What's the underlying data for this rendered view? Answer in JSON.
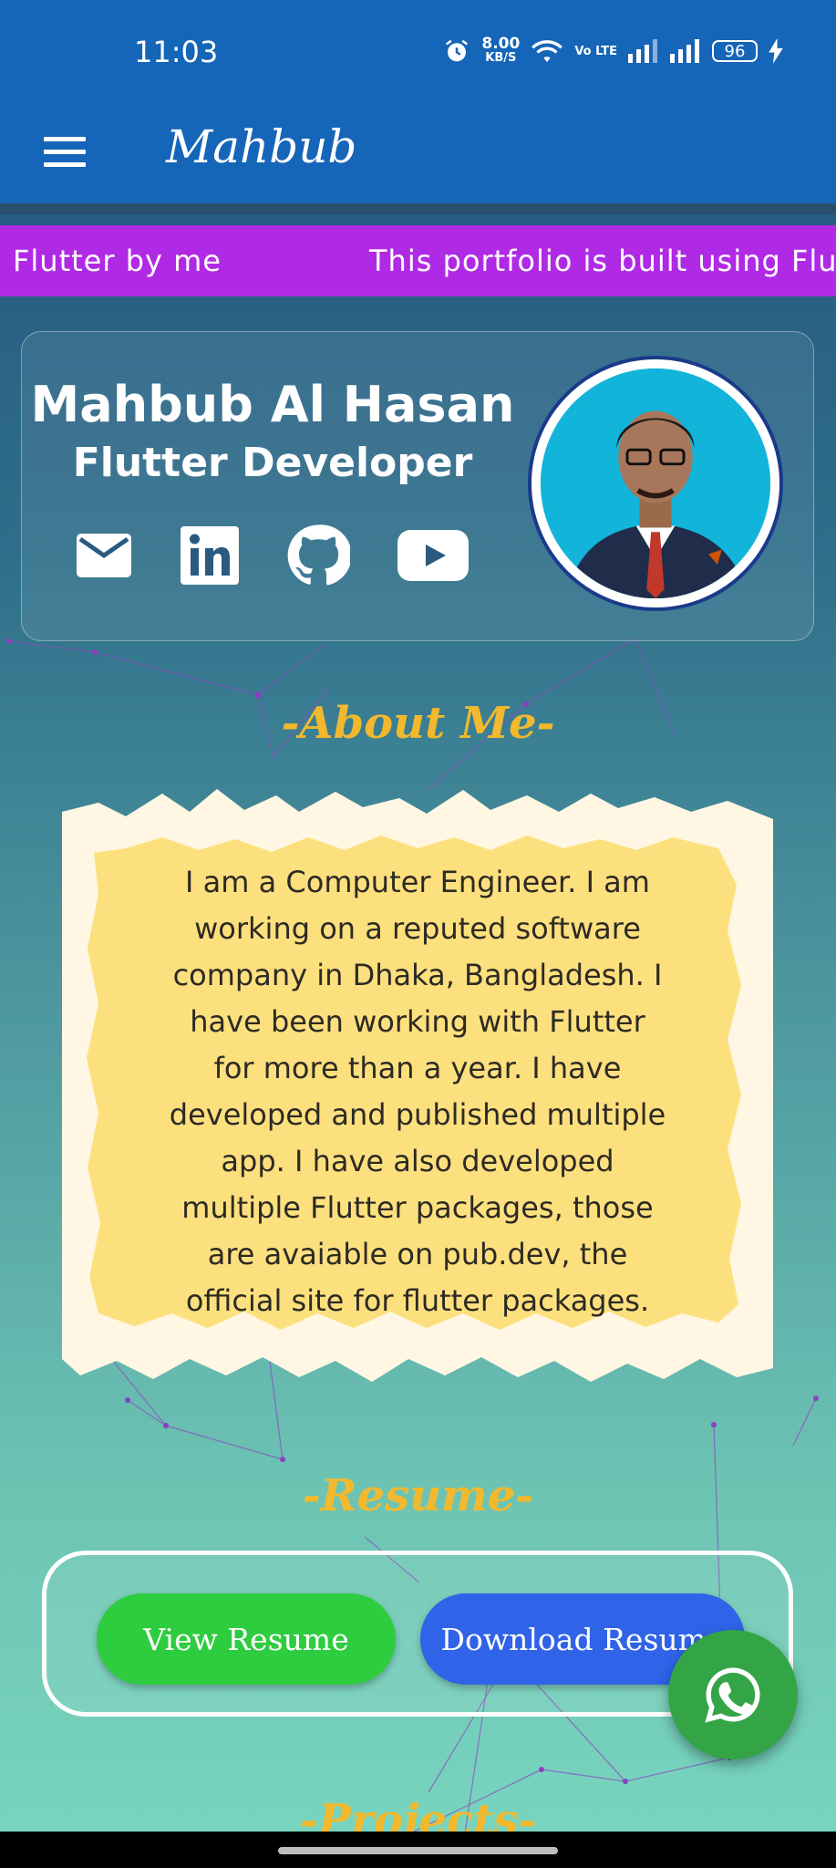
{
  "status_bar": {
    "time": "11:03",
    "net_speed": "8.00",
    "net_unit": "KB/S",
    "volte": "Vo LTE",
    "battery": "96"
  },
  "app_bar": {
    "title": "Mahbub",
    "menu_icon": "hamburger-menu-icon"
  },
  "marquee": {
    "text_left": "Flutter by me",
    "text_right": "This portfolio is built using Flut"
  },
  "profile": {
    "name": "Mahbub Al Hasan",
    "role": "Flutter Developer",
    "social_icons": [
      "email-icon",
      "linkedin-icon",
      "github-icon",
      "youtube-icon"
    ]
  },
  "about": {
    "title": "-About Me-",
    "lines": [
      "I am a Computer Engineer. I am",
      "working on a reputed software",
      "company in Dhaka, Bangladesh. I",
      "have been working with Flutter",
      "for more than a year. I have",
      "developed and published multiple",
      "app. I have also developed",
      "multiple Flutter packages, those",
      "are avaiable on pub.dev, the",
      "official site for flutter packages."
    ]
  },
  "resume": {
    "title": "-Resume-",
    "view_label": "View Resume",
    "download_label": "Download Resume"
  },
  "projects": {
    "title": "-Projects-"
  },
  "fab": {
    "icon": "whatsapp-icon"
  },
  "colors": {
    "app_bar": "#1565b8",
    "marquee": "#b02ae6",
    "accent_title": "#f2b92e",
    "view_button": "#2ecc3f",
    "download_button": "#2f63e8",
    "fab": "#33a546"
  }
}
